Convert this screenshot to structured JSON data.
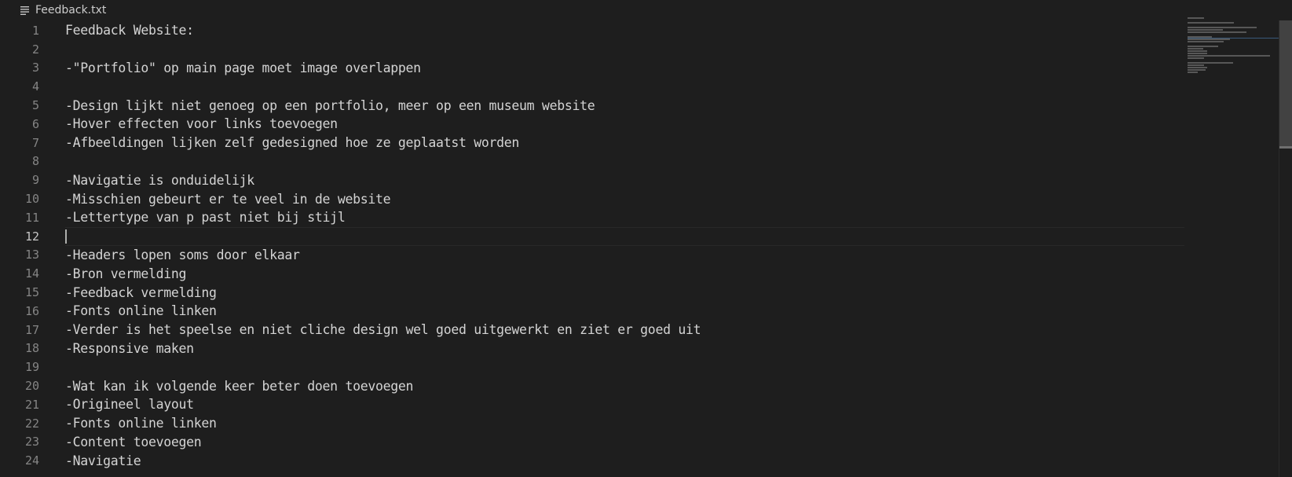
{
  "breadcrumb": {
    "icon": "file-lines-icon",
    "filename": "Feedback.txt"
  },
  "editor": {
    "current_line": 12,
    "lines": [
      {
        "n": "1",
        "text": "Feedback Website:"
      },
      {
        "n": "2",
        "text": ""
      },
      {
        "n": "3",
        "text": "-\"Portfolio\" op main page moet image overlappen"
      },
      {
        "n": "4",
        "text": ""
      },
      {
        "n": "5",
        "text": "-Design lijkt niet genoeg op een portfolio, meer op een museum website"
      },
      {
        "n": "6",
        "text": "-Hover effecten voor links toevoegen"
      },
      {
        "n": "7",
        "text": "-Afbeeldingen lijken zelf gedesigned hoe ze geplaatst worden"
      },
      {
        "n": "8",
        "text": ""
      },
      {
        "n": "9",
        "text": "-Navigatie is onduidelijk"
      },
      {
        "n": "10",
        "text": "-Misschien gebeurt er te veel in de website"
      },
      {
        "n": "11",
        "text": "-Lettertype van p past niet bij stijl"
      },
      {
        "n": "12",
        "text": ""
      },
      {
        "n": "13",
        "text": "-Headers lopen soms door elkaar"
      },
      {
        "n": "14",
        "text": "-Bron vermelding"
      },
      {
        "n": "15",
        "text": "-Feedback vermelding"
      },
      {
        "n": "16",
        "text": "-Fonts online linken"
      },
      {
        "n": "17",
        "text": "-Verder is het speelse en niet cliche design wel goed uitgewerkt en ziet er goed uit"
      },
      {
        "n": "18",
        "text": "-Responsive maken"
      },
      {
        "n": "19",
        "text": ""
      },
      {
        "n": "20",
        "text": "-Wat kan ik volgende keer beter doen toevoegen"
      },
      {
        "n": "21",
        "text": "-Origineel layout"
      },
      {
        "n": "22",
        "text": "-Fonts online linken"
      },
      {
        "n": "23",
        "text": "-Content toevoegen"
      },
      {
        "n": "24",
        "text": "-Navigatie"
      }
    ]
  },
  "colors": {
    "background": "#1e1e1e",
    "text": "#d4d4d4",
    "line_number": "#858585",
    "scrollbar_thumb": "#424242"
  }
}
